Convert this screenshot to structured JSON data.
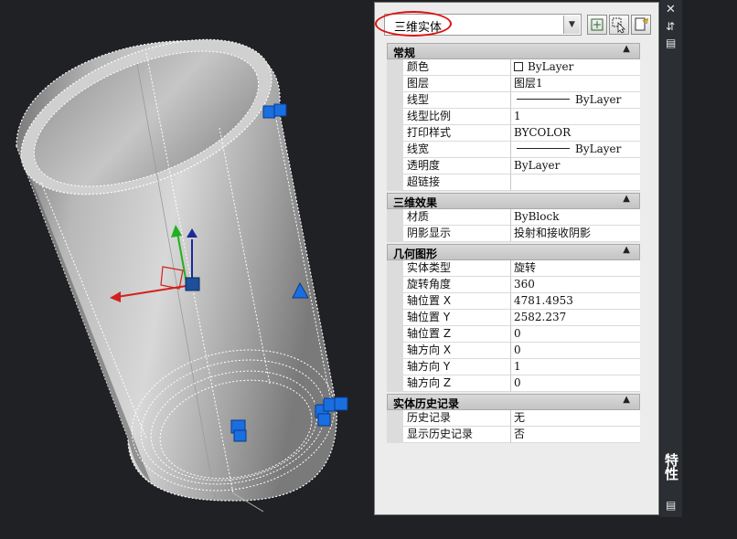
{
  "viewport": {
    "label": "3d-viewport"
  },
  "palette": {
    "title": "特性",
    "selection": "三维实体",
    "close_glyph": "✕",
    "pin_glyph": "⇵",
    "menu_glyph": "▤",
    "dropdown_glyph": "▼",
    "sections": [
      {
        "title": "常规",
        "rows": [
          {
            "name": "颜色",
            "value": "ByLayer",
            "swatch": true
          },
          {
            "name": "图层",
            "value": "图层1"
          },
          {
            "name": "线型",
            "value": "ByLayer",
            "line": true
          },
          {
            "name": "线型比例",
            "value": "1"
          },
          {
            "name": "打印样式",
            "value": "BYCOLOR"
          },
          {
            "name": "线宽",
            "value": "ByLayer",
            "line": true
          },
          {
            "name": "透明度",
            "value": "ByLayer"
          },
          {
            "name": "超链接",
            "value": ""
          }
        ]
      },
      {
        "title": "三维效果",
        "rows": [
          {
            "name": "材质",
            "value": "ByBlock"
          },
          {
            "name": "阴影显示",
            "value": "投射和接收阴影"
          }
        ]
      },
      {
        "title": "几何图形",
        "rows": [
          {
            "name": "实体类型",
            "value": "旋转"
          },
          {
            "name": "旋转角度",
            "value": "360"
          },
          {
            "name": "轴位置 X",
            "value": "4781.4953"
          },
          {
            "name": "轴位置 Y",
            "value": "2582.237"
          },
          {
            "name": "轴位置 Z",
            "value": "0"
          },
          {
            "name": "轴方向 X",
            "value": "0"
          },
          {
            "name": "轴方向 Y",
            "value": "1"
          },
          {
            "name": "轴方向 Z",
            "value": "0"
          }
        ]
      },
      {
        "title": "实体历史记录",
        "rows": [
          {
            "name": "历史记录",
            "value": "无"
          },
          {
            "name": "显示历史记录",
            "value": "否"
          }
        ]
      }
    ],
    "colors": {
      "grip": "#1a6fe0",
      "ucs_x": "#d42020",
      "ucs_y": "#20b020",
      "ucs_z": "#1a2a9a",
      "selection_oval": "#dd1111"
    }
  }
}
